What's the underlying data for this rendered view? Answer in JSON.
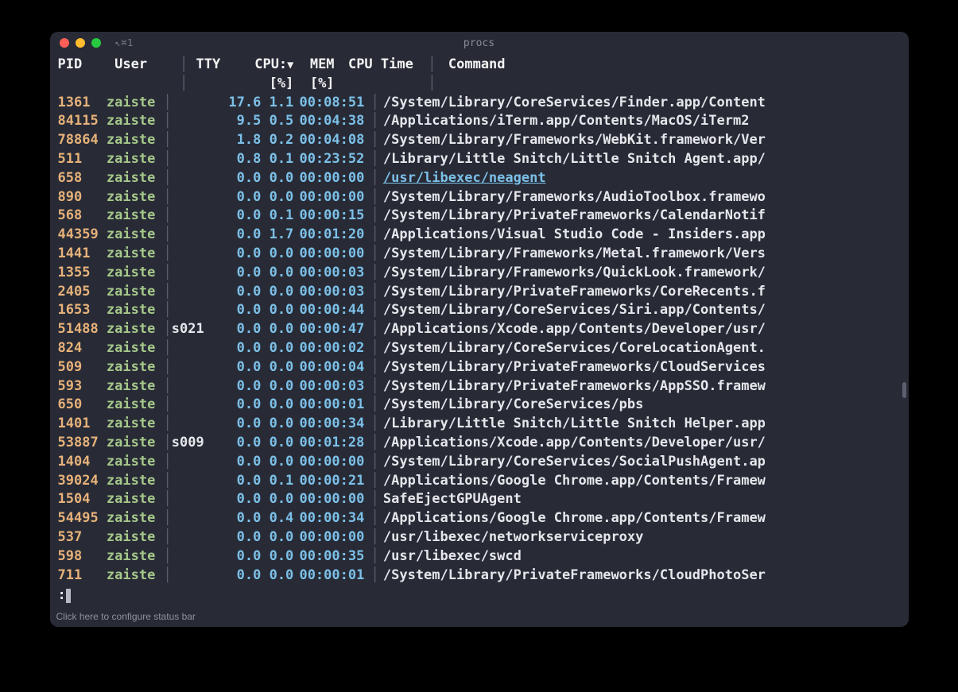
{
  "window": {
    "tab_label": "⌘1",
    "tab_prefix": "↖",
    "title": "procs"
  },
  "headers": {
    "pid": "PID",
    "user": "User",
    "sep": "│",
    "tty": "TTY",
    "cpu": "CPU:",
    "sort_arrow": "▼",
    "mem": "MEM",
    "time": "CPU Time",
    "sep2": "│",
    "cmd": "Command",
    "cpu_unit": "[%]",
    "mem_unit": "[%]"
  },
  "rows": [
    {
      "pid": "1361",
      "user": "zaiste",
      "tty": "",
      "cpu": "17.6",
      "mem": "1.1",
      "time": "00:08:51",
      "cmd": "/System/Library/CoreServices/Finder.app/Content",
      "link": false
    },
    {
      "pid": "84115",
      "user": "zaiste",
      "tty": "",
      "cpu": "9.5",
      "mem": "0.5",
      "time": "00:04:38",
      "cmd": "/Applications/iTerm.app/Contents/MacOS/iTerm2",
      "link": false
    },
    {
      "pid": "78864",
      "user": "zaiste",
      "tty": "",
      "cpu": "1.8",
      "mem": "0.2",
      "time": "00:04:08",
      "cmd": "/System/Library/Frameworks/WebKit.framework/Ver",
      "link": false
    },
    {
      "pid": "511",
      "user": "zaiste",
      "tty": "",
      "cpu": "0.8",
      "mem": "0.1",
      "time": "00:23:52",
      "cmd": "/Library/Little Snitch/Little Snitch Agent.app/",
      "link": false
    },
    {
      "pid": "658",
      "user": "zaiste",
      "tty": "",
      "cpu": "0.0",
      "mem": "0.0",
      "time": "00:00:00",
      "cmd": "/usr/libexec/neagent",
      "link": true
    },
    {
      "pid": "890",
      "user": "zaiste",
      "tty": "",
      "cpu": "0.0",
      "mem": "0.0",
      "time": "00:00:00",
      "cmd": "/System/Library/Frameworks/AudioToolbox.framewo",
      "link": false
    },
    {
      "pid": "568",
      "user": "zaiste",
      "tty": "",
      "cpu": "0.0",
      "mem": "0.1",
      "time": "00:00:15",
      "cmd": "/System/Library/PrivateFrameworks/CalendarNotif",
      "link": false
    },
    {
      "pid": "44359",
      "user": "zaiste",
      "tty": "",
      "cpu": "0.0",
      "mem": "1.7",
      "time": "00:01:20",
      "cmd": "/Applications/Visual Studio Code - Insiders.app",
      "link": false
    },
    {
      "pid": "1441",
      "user": "zaiste",
      "tty": "",
      "cpu": "0.0",
      "mem": "0.0",
      "time": "00:00:00",
      "cmd": "/System/Library/Frameworks/Metal.framework/Vers",
      "link": false
    },
    {
      "pid": "1355",
      "user": "zaiste",
      "tty": "",
      "cpu": "0.0",
      "mem": "0.0",
      "time": "00:00:03",
      "cmd": "/System/Library/Frameworks/QuickLook.framework/",
      "link": false
    },
    {
      "pid": "2405",
      "user": "zaiste",
      "tty": "",
      "cpu": "0.0",
      "mem": "0.0",
      "time": "00:00:03",
      "cmd": "/System/Library/PrivateFrameworks/CoreRecents.f",
      "link": false
    },
    {
      "pid": "1653",
      "user": "zaiste",
      "tty": "",
      "cpu": "0.0",
      "mem": "0.0",
      "time": "00:00:44",
      "cmd": "/System/Library/CoreServices/Siri.app/Contents/",
      "link": false
    },
    {
      "pid": "51488",
      "user": "zaiste",
      "tty": "s021",
      "cpu": "0.0",
      "mem": "0.0",
      "time": "00:00:47",
      "cmd": "/Applications/Xcode.app/Contents/Developer/usr/",
      "link": false
    },
    {
      "pid": "824",
      "user": "zaiste",
      "tty": "",
      "cpu": "0.0",
      "mem": "0.0",
      "time": "00:00:02",
      "cmd": "/System/Library/CoreServices/CoreLocationAgent.",
      "link": false
    },
    {
      "pid": "509",
      "user": "zaiste",
      "tty": "",
      "cpu": "0.0",
      "mem": "0.0",
      "time": "00:00:04",
      "cmd": "/System/Library/PrivateFrameworks/CloudServices",
      "link": false
    },
    {
      "pid": "593",
      "user": "zaiste",
      "tty": "",
      "cpu": "0.0",
      "mem": "0.0",
      "time": "00:00:03",
      "cmd": "/System/Library/PrivateFrameworks/AppSSO.framew",
      "link": false
    },
    {
      "pid": "650",
      "user": "zaiste",
      "tty": "",
      "cpu": "0.0",
      "mem": "0.0",
      "time": "00:00:01",
      "cmd": "/System/Library/CoreServices/pbs",
      "link": false
    },
    {
      "pid": "1401",
      "user": "zaiste",
      "tty": "",
      "cpu": "0.0",
      "mem": "0.0",
      "time": "00:00:34",
      "cmd": "/Library/Little Snitch/Little Snitch Helper.app",
      "link": false
    },
    {
      "pid": "53887",
      "user": "zaiste",
      "tty": "s009",
      "cpu": "0.0",
      "mem": "0.0",
      "time": "00:01:28",
      "cmd": "/Applications/Xcode.app/Contents/Developer/usr/",
      "link": false
    },
    {
      "pid": "1404",
      "user": "zaiste",
      "tty": "",
      "cpu": "0.0",
      "mem": "0.0",
      "time": "00:00:00",
      "cmd": "/System/Library/CoreServices/SocialPushAgent.ap",
      "link": false
    },
    {
      "pid": "39024",
      "user": "zaiste",
      "tty": "",
      "cpu": "0.0",
      "mem": "0.1",
      "time": "00:00:21",
      "cmd": "/Applications/Google Chrome.app/Contents/Framew",
      "link": false
    },
    {
      "pid": "1504",
      "user": "zaiste",
      "tty": "",
      "cpu": "0.0",
      "mem": "0.0",
      "time": "00:00:00",
      "cmd": "SafeEjectGPUAgent",
      "link": false
    },
    {
      "pid": "54495",
      "user": "zaiste",
      "tty": "",
      "cpu": "0.0",
      "mem": "0.4",
      "time": "00:00:34",
      "cmd": "/Applications/Google Chrome.app/Contents/Framew",
      "link": false
    },
    {
      "pid": "537",
      "user": "zaiste",
      "tty": "",
      "cpu": "0.0",
      "mem": "0.0",
      "time": "00:00:00",
      "cmd": "/usr/libexec/networkserviceproxy",
      "link": false
    },
    {
      "pid": "598",
      "user": "zaiste",
      "tty": "",
      "cpu": "0.0",
      "mem": "0.0",
      "time": "00:00:35",
      "cmd": "/usr/libexec/swcd",
      "link": false
    },
    {
      "pid": "711",
      "user": "zaiste",
      "tty": "",
      "cpu": "0.0",
      "mem": "0.0",
      "time": "00:00:01",
      "cmd": "/System/Library/PrivateFrameworks/CloudPhotoSer",
      "link": false
    }
  ],
  "prompt": ":",
  "statusbar": "Click here to configure status bar"
}
